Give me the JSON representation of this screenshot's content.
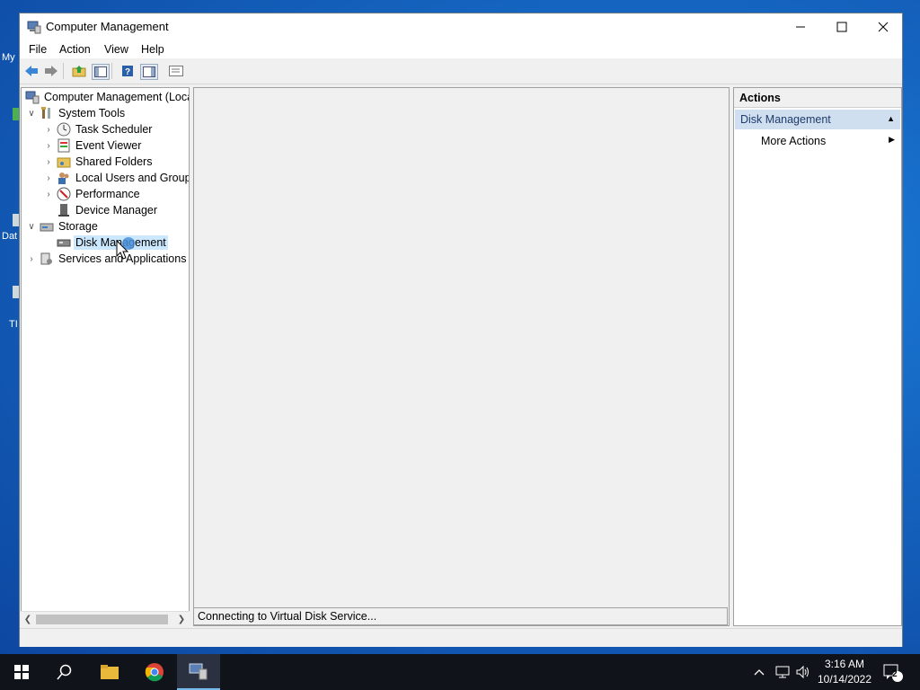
{
  "desktop": {
    "icon_labels": [
      "My",
      "Dat",
      "TI"
    ]
  },
  "window": {
    "title": "Computer Management",
    "controls": {
      "minimize": "—",
      "maximize": "☐",
      "close": "✕"
    }
  },
  "menu": [
    "File",
    "Action",
    "View",
    "Help"
  ],
  "toolbar": {
    "buttons": [
      "back-icon",
      "forward-icon",
      "up-folder-icon",
      "show-hide-tree-icon",
      "help-icon",
      "show-hide-action-pane-icon",
      "properties-icon"
    ]
  },
  "tree": {
    "root": "Computer Management (Local",
    "system_tools": "System Tools",
    "task_scheduler": "Task Scheduler",
    "event_viewer": "Event Viewer",
    "shared_folders": "Shared Folders",
    "local_users": "Local Users and Groups",
    "performance": "Performance",
    "device_manager": "Device Manager",
    "storage": "Storage",
    "disk_management": "Disk Management",
    "services_apps": "Services and Applications"
  },
  "center": {
    "status": "Connecting to Virtual Disk Service..."
  },
  "actions": {
    "header": "Actions",
    "section": "Disk Management",
    "more_actions": "More Actions"
  },
  "taskbar": {
    "time": "3:16 AM",
    "date": "10/14/2022",
    "notification_count": "2"
  },
  "colors": {
    "selection": "#cce8ff",
    "action_section": "#cfdff0",
    "taskbar": "#10131a",
    "desktop": "#1565c0"
  }
}
